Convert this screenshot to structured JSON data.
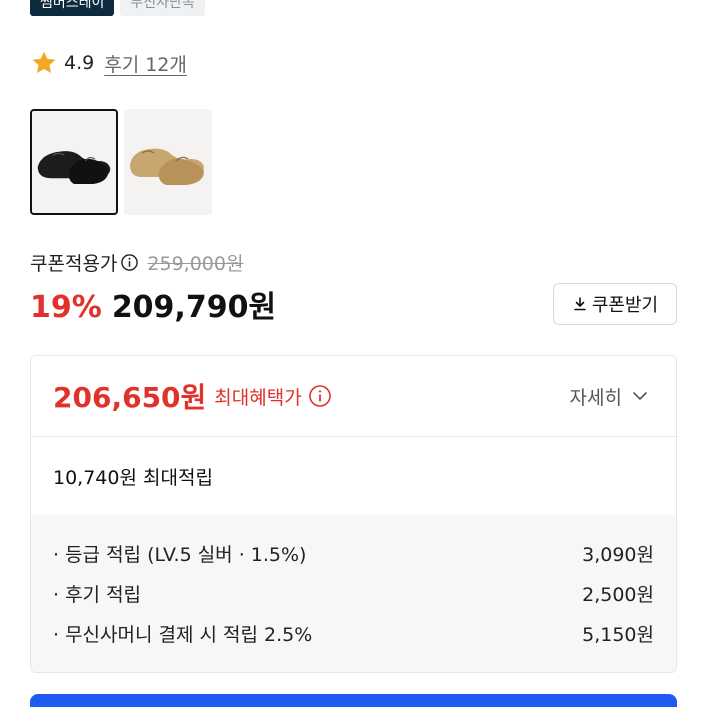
{
  "badges": [
    "썸머스테이",
    "무신사단독"
  ],
  "rating": {
    "score": "4.9",
    "reviews": "후기 12개"
  },
  "thumbnails": [
    {
      "name": "black-shoe",
      "selected": true
    },
    {
      "name": "beige-shoe",
      "selected": false
    }
  ],
  "pricing": {
    "coupon_label": "쿠폰적용가",
    "original_price": "259,000원",
    "discount": "19%",
    "sale_price": "209,790원",
    "coupon_button": "쿠폰받기"
  },
  "benefit": {
    "max_price": "206,650원",
    "max_label": "최대혜택가",
    "detail_toggle": "자세히",
    "total_points": "10,740원 최대적립",
    "items": [
      {
        "label": "· 등급 적립 (LV.5 실버 · 1.5%)",
        "value": "3,090원"
      },
      {
        "label": "· 후기 적립",
        "value": "2,500원"
      },
      {
        "label": "· 무신사머니 결제 시 적립 2.5%",
        "value": "5,150원"
      }
    ]
  },
  "colors": {
    "accent_red": "#e0312b",
    "cta_blue": "#1f5bf0",
    "badge_dark": "#0d2b3e",
    "star": "#f5a623"
  }
}
